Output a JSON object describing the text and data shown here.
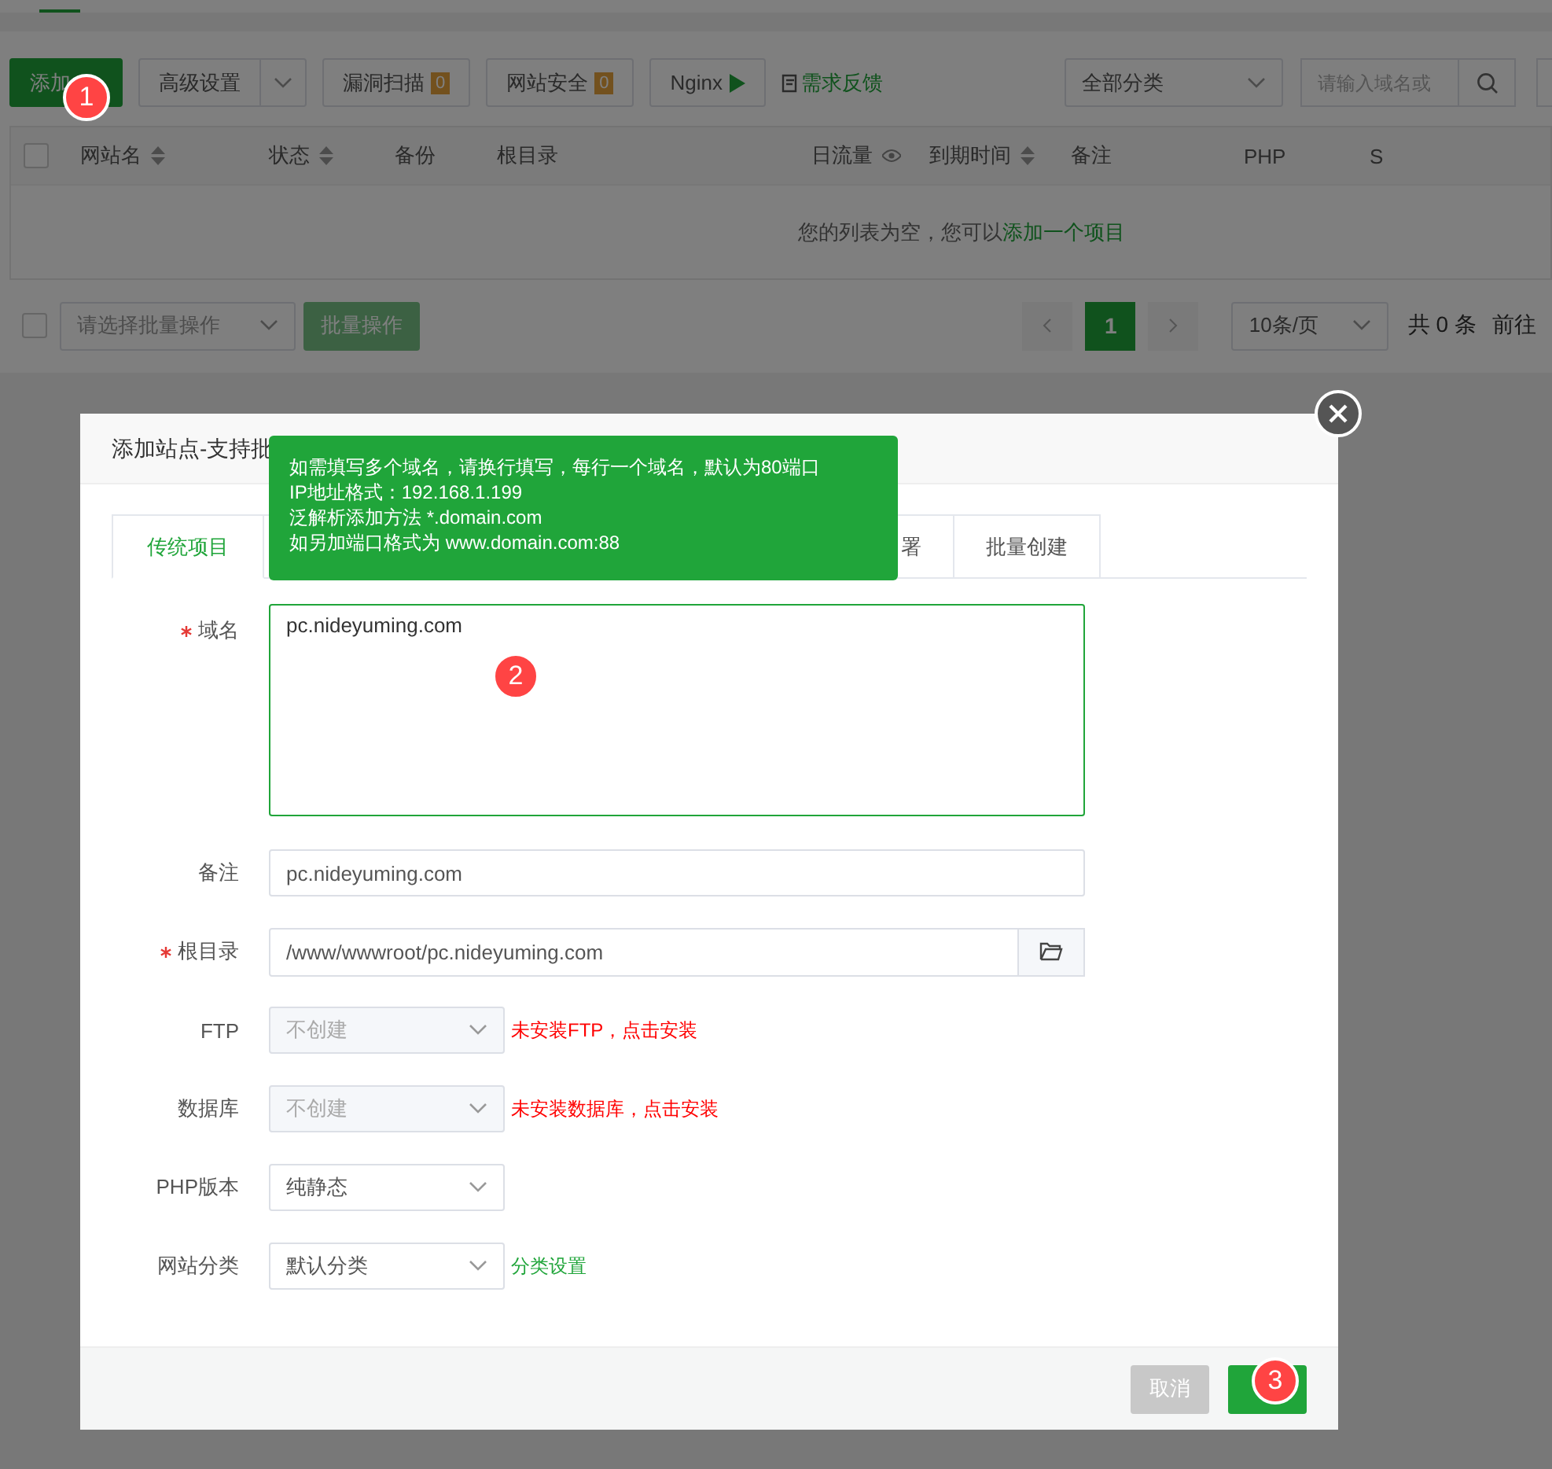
{
  "toolbar": {
    "add_button": "添加",
    "advanced_button": "高级设置",
    "scan_button": {
      "label": "漏洞扫描",
      "count": "0"
    },
    "security_button": {
      "label": "网站安全",
      "count": "0"
    },
    "nginx_button": "Nginx",
    "feedback_link": "需求反馈",
    "category_select": "全部分类",
    "search": {
      "placeholder": "请输入域名或"
    }
  },
  "table": {
    "select_all": {
      "checked": false
    },
    "columns": [
      {
        "label": "网站名",
        "kind": "sort"
      },
      {
        "label": "状态",
        "kind": "sort"
      },
      {
        "label": "备份",
        "kind": "plain"
      },
      {
        "label": "根目录",
        "kind": "plain"
      },
      {
        "label": "日流量",
        "kind": "eye"
      },
      {
        "label": "到期时间",
        "kind": "sort"
      },
      {
        "label": "备注",
        "kind": "plain"
      },
      {
        "label": "PHP",
        "kind": "plain"
      },
      {
        "label": "S",
        "kind": "plain"
      }
    ],
    "empty_text": "您的列表为空，您可以",
    "empty_link": "添加一个项目"
  },
  "footer": {
    "select_all": {
      "checked": false
    },
    "batch_select": {
      "placeholder": "请选择批量操作"
    },
    "batch_button": "批量操作",
    "pages": [
      {
        "label": "1",
        "selected": true
      }
    ],
    "page_size": "10条/页",
    "total": "共 0 条",
    "goto": "前往"
  },
  "dialog": {
    "title": "添加站点-支持批",
    "tooltip": [
      "如需填写多个域名，请换行填写，每行一个域名，默认为80端口",
      "IP地址格式：192.168.1.199",
      "泛解析添加方法 *.domain.com",
      "如另加端口格式为 www.domain.com:88"
    ],
    "tabs": [
      {
        "label": "传统项目",
        "selected": true
      },
      {
        "label": "署",
        "selected": false
      },
      {
        "label": "批量创建",
        "selected": false
      }
    ],
    "fields": [
      {
        "label": "域名",
        "kind": "textarea",
        "required": true,
        "value": "pc.nideyuming.com"
      },
      {
        "label": "备注",
        "kind": "input",
        "required": false,
        "value": "pc.nideyuming.com"
      },
      {
        "label": "根目录",
        "kind": "path",
        "required": true,
        "value": "/www/wwwroot/pc.nideyuming.com"
      },
      {
        "label": "FTP",
        "kind": "select",
        "required": false,
        "value": "不创建",
        "disabled": true,
        "note": {
          "text": "未安装FTP，点击安装",
          "color": "#ff0000"
        }
      },
      {
        "label": "数据库",
        "kind": "select",
        "required": false,
        "value": "不创建",
        "disabled": true,
        "note": {
          "text": "未安装数据库，点击安装",
          "color": "#ff0000"
        }
      },
      {
        "label": "PHP版本",
        "kind": "select",
        "required": false,
        "value": "纯静态",
        "disabled": false
      },
      {
        "label": "网站分类",
        "kind": "select",
        "required": false,
        "value": "默认分类",
        "disabled": false,
        "note": {
          "text": "分类设置",
          "color": "#20a53a"
        }
      }
    ],
    "cancel_button": "取消"
  },
  "steps": [
    "1",
    "2",
    "3"
  ]
}
